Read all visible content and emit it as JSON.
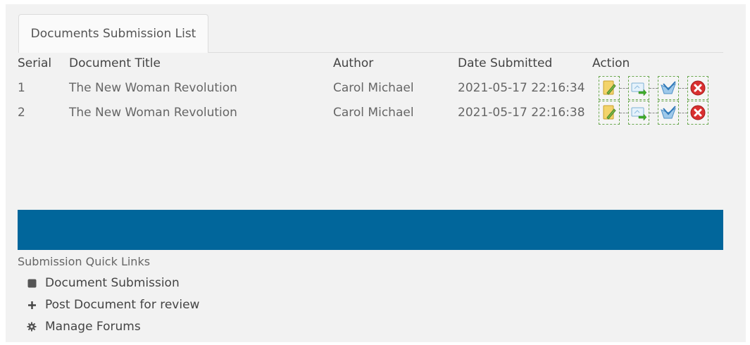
{
  "tab": {
    "label": "Documents Submission List"
  },
  "table": {
    "headers": {
      "serial": "Serial",
      "title": "Document Title",
      "author": "Author",
      "date": "Date Submitted",
      "action": "Action"
    },
    "rows": [
      {
        "serial": "1",
        "title": "The New Woman Revolution",
        "author": "Carol Michael",
        "date": "2021-05-17 22:16:34"
      },
      {
        "serial": "2",
        "title": "The New Woman Revolution",
        "author": "Carol Michael",
        "date": "2021-05-17 22:16:38"
      }
    ],
    "action_icons": [
      "edit-icon",
      "send-icon",
      "approve-icon",
      "delete-icon"
    ]
  },
  "colors": {
    "banner": "#01669b",
    "panel_bg": "#f2f2f2"
  },
  "quick_links": {
    "title": "Submission Quick Links",
    "items": [
      {
        "label": "Document Submission",
        "icon": "square-icon"
      },
      {
        "label": "Post Document for review",
        "icon": "plus-icon"
      },
      {
        "label": "Manage Forums",
        "icon": "gear-icon"
      }
    ]
  }
}
